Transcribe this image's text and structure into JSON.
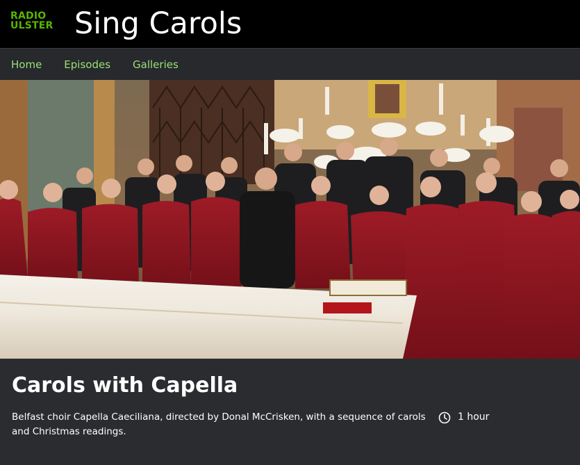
{
  "header": {
    "brand_line1": "RADIO",
    "brand_line2": "ULSTER",
    "title": "Sing Carols"
  },
  "nav": {
    "items": [
      {
        "label": "Home"
      },
      {
        "label": "Episodes"
      },
      {
        "label": "Galleries"
      }
    ]
  },
  "hero": {
    "icon": "choir-photo-image"
  },
  "episode": {
    "title": "Carols with Capella",
    "synopsis": "Belfast choir Capella Caeciliana, directed by Donal McCrisken, with a sequence of carols and Christmas readings.",
    "duration": "1 hour",
    "duration_icon": "clock-icon"
  },
  "colors": {
    "header_bg": "#000000",
    "brand_green": "#5ab400",
    "nav_bg": "#27292c",
    "nav_link": "#9ce07a",
    "info_bg": "#2b2c2f",
    "choir_red": "#8e1420"
  }
}
